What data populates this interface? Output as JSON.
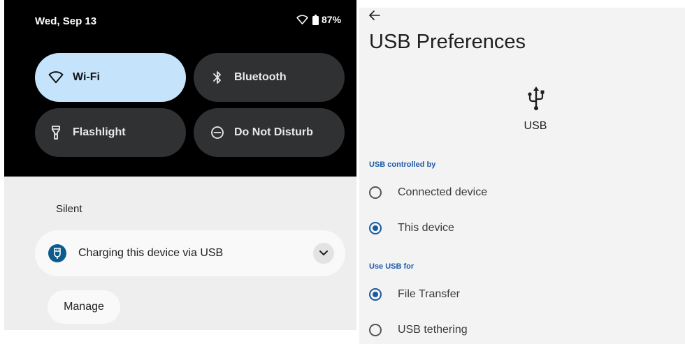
{
  "quick_settings": {
    "date": "Wed, Sep 13",
    "battery": "87%",
    "tiles": {
      "wifi": {
        "label": "Wi-Fi",
        "active": true
      },
      "bluetooth": {
        "label": "Bluetooth",
        "active": false
      },
      "flashlight": {
        "label": "Flashlight",
        "active": false
      },
      "dnd": {
        "label": "Do Not Disturb",
        "active": false
      }
    }
  },
  "notifications": {
    "section_label": "Silent",
    "items": [
      {
        "text": "Charging this device via USB",
        "icon": "usb-icon"
      }
    ],
    "manage_label": "Manage"
  },
  "usb_preferences": {
    "title": "USB Preferences",
    "icon": "usb-icon",
    "icon_label": "USB",
    "controlled_by": {
      "heading": "USB controlled by",
      "options": [
        {
          "label": "Connected device",
          "selected": false
        },
        {
          "label": "This device",
          "selected": true
        }
      ]
    },
    "use_for": {
      "heading": "Use USB for",
      "options": [
        {
          "label": "File Transfer",
          "selected": true
        },
        {
          "label": "USB tethering",
          "selected": false
        }
      ]
    }
  },
  "colors": {
    "accent": "#1a5aa0",
    "tile_active": "#c5e4fb",
    "tile_inactive": "#2f3133",
    "notif_icon_bg": "#0b5c8c"
  }
}
